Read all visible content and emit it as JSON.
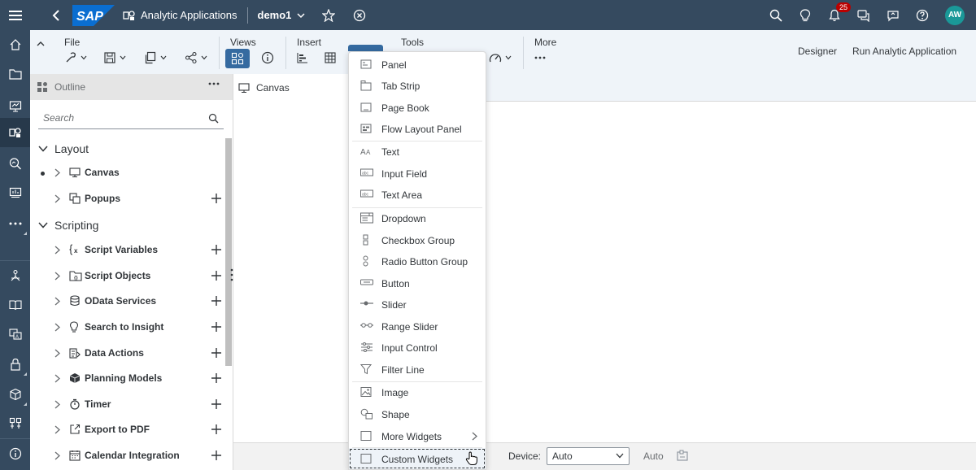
{
  "shell": {
    "logo_text": "SAP",
    "app_title": "Analytic Applications",
    "document_name": "demo1",
    "notification_count": "25",
    "user_initials": "AW"
  },
  "toolbar": {
    "groups": {
      "file": "File",
      "views": "Views",
      "insert": "Insert",
      "tools": "Tools",
      "more": "More"
    },
    "designer": "Designer",
    "run": "Run Analytic Application"
  },
  "outline": {
    "title": "Outline",
    "search_placeholder": "Search",
    "sections": {
      "layout": "Layout",
      "scripting": "Scripting"
    },
    "layout_items": [
      "Canvas",
      "Popups"
    ],
    "scripting_items": [
      "Script Variables",
      "Script Objects",
      "OData Services",
      "Search to Insight",
      "Data Actions",
      "Planning Models",
      "Timer",
      "Export to PDF",
      "Calendar Integration"
    ]
  },
  "canvas": {
    "tab_label": "Canvas"
  },
  "bottom": {
    "device_label": "Device:",
    "device_value": "Auto",
    "auto_label": "Auto"
  },
  "insert_menu": {
    "items": [
      "Panel",
      "Tab Strip",
      "Page Book",
      "Flow Layout Panel",
      "Text",
      "Input Field",
      "Text Area",
      "Dropdown",
      "Checkbox Group",
      "Radio Button Group",
      "Button",
      "Slider",
      "Range Slider",
      "Input Control",
      "Filter Line",
      "Image",
      "Shape",
      "More Widgets",
      "Custom Widgets"
    ]
  },
  "colors": {
    "shell_bg": "#354a5f",
    "toolbar_bg": "#eff4f9",
    "accent": "#356aa0",
    "badge": "#bb0000",
    "avatar": "#1a9898"
  }
}
